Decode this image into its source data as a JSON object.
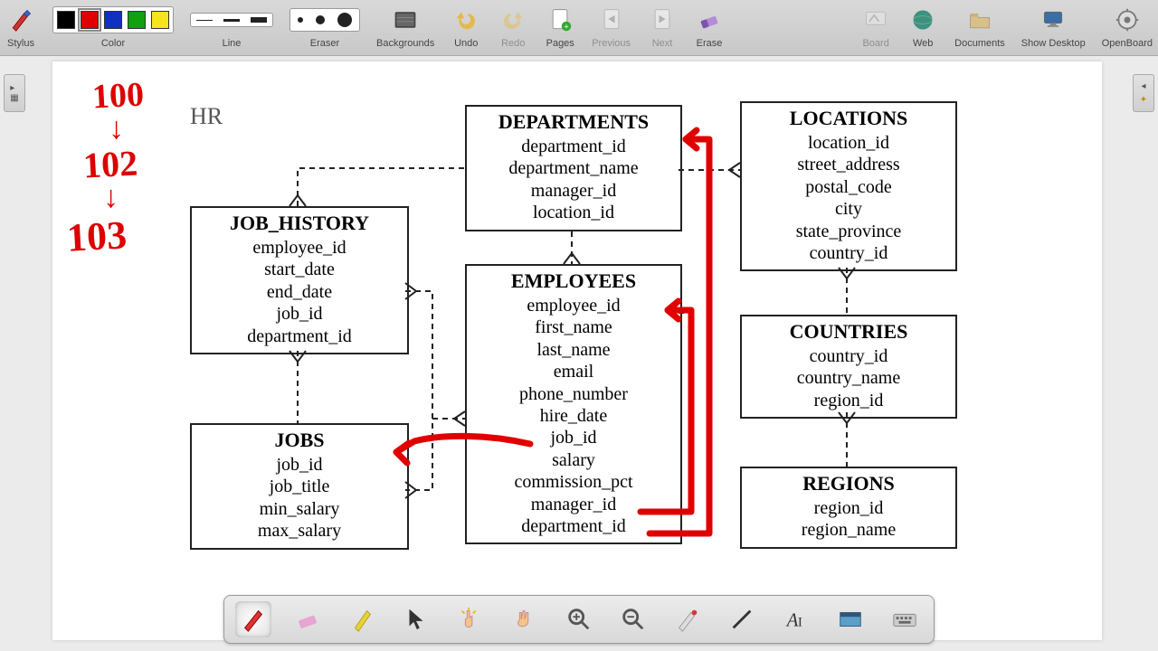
{
  "toolbar": {
    "stylus": "Stylus",
    "color": "Color",
    "line": "Line",
    "eraser": "Eraser",
    "backgrounds": "Backgrounds",
    "undo": "Undo",
    "redo": "Redo",
    "pages": "Pages",
    "previous": "Previous",
    "next": "Next",
    "erase": "Erase",
    "board": "Board",
    "web": "Web",
    "documents": "Documents",
    "show_desktop": "Show Desktop",
    "openboard": "OpenBoard"
  },
  "colors": [
    "#000000",
    "#e00000",
    "#1030c0",
    "#10a010",
    "#f5e51a"
  ],
  "schema_label": "HR",
  "handwriting": [
    "100",
    "102",
    "103"
  ],
  "tables": {
    "job_history": {
      "title": "JOB_HISTORY",
      "cols": [
        "employee_id",
        "start_date",
        "end_date",
        "job_id",
        "department_id"
      ]
    },
    "jobs": {
      "title": "JOBS",
      "cols": [
        "job_id",
        "job_title",
        "min_salary",
        "max_salary"
      ]
    },
    "departments": {
      "title": "DEPARTMENTS",
      "cols": [
        "department_id",
        "department_name",
        "manager_id",
        "location_id"
      ]
    },
    "employees": {
      "title": "EMPLOYEES",
      "cols": [
        "employee_id",
        "first_name",
        "last_name",
        "email",
        "phone_number",
        "hire_date",
        "job_id",
        "salary",
        "commission_pct",
        "manager_id",
        "department_id"
      ]
    },
    "locations": {
      "title": "LOCATIONS",
      "cols": [
        "location_id",
        "street_address",
        "postal_code",
        "city",
        "state_province",
        "country_id"
      ]
    },
    "countries": {
      "title": "COUNTRIES",
      "cols": [
        "country_id",
        "country_name",
        "region_id"
      ]
    },
    "regions": {
      "title": "REGIONS",
      "cols": [
        "region_id",
        "region_name"
      ]
    }
  },
  "dock": {
    "pen": "pen-tool",
    "eraser": "eraser-tool",
    "marker": "marker-tool",
    "pointer": "pointer-tool",
    "interact": "interact-tool",
    "hand": "hand-tool",
    "zoom_in": "zoom-in-tool",
    "zoom_out": "zoom-out-tool",
    "laser": "laser-tool",
    "line": "line-tool",
    "text": "text-tool",
    "capture": "capture-tool",
    "keyboard": "keyboard-tool"
  }
}
